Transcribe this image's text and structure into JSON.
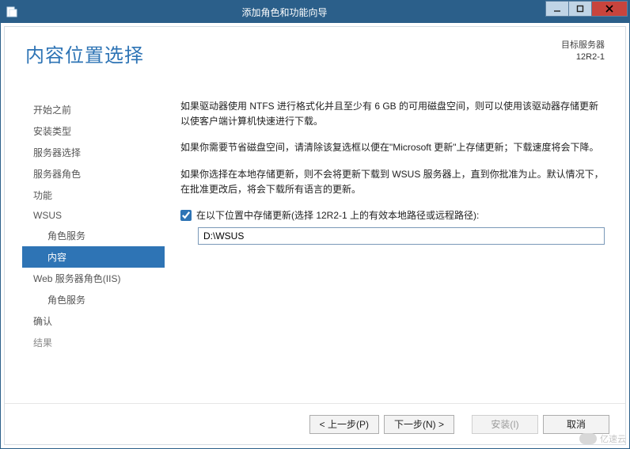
{
  "titlebar": {
    "title": "添加角色和功能向导"
  },
  "header": {
    "heading": "内容位置选择",
    "dest_label": "目标服务器",
    "dest_server": "12R2-1"
  },
  "nav": {
    "items": [
      {
        "label": "开始之前"
      },
      {
        "label": "安装类型"
      },
      {
        "label": "服务器选择"
      },
      {
        "label": "服务器角色"
      },
      {
        "label": "功能"
      },
      {
        "label": "WSUS"
      },
      {
        "label": "角色服务"
      },
      {
        "label": "内容"
      },
      {
        "label": "Web 服务器角色(IIS)"
      },
      {
        "label": "角色服务"
      },
      {
        "label": "确认"
      },
      {
        "label": "结果"
      }
    ]
  },
  "content": {
    "p1": "如果驱动器使用 NTFS 进行格式化并且至少有 6 GB 的可用磁盘空间，则可以使用该驱动器存储更新以使客户端计算机快速进行下载。",
    "p2": "如果你需要节省磁盘空间，请清除该复选框以便在\"Microsoft 更新\"上存储更新；下载速度将会下降。",
    "p3": "如果你选择在本地存储更新，则不会将更新下载到 WSUS 服务器上，直到你批准为止。默认情况下，在批准更改后，将会下载所有语言的更新。",
    "checkbox_label": "在以下位置中存储更新(选择 12R2-1 上的有效本地路径或远程路径):",
    "path_value": "D:\\WSUS"
  },
  "footer": {
    "prev": "< 上一步(P)",
    "next": "下一步(N) >",
    "install": "安装(I)",
    "cancel": "取消"
  },
  "watermark": {
    "text": "亿速云"
  }
}
